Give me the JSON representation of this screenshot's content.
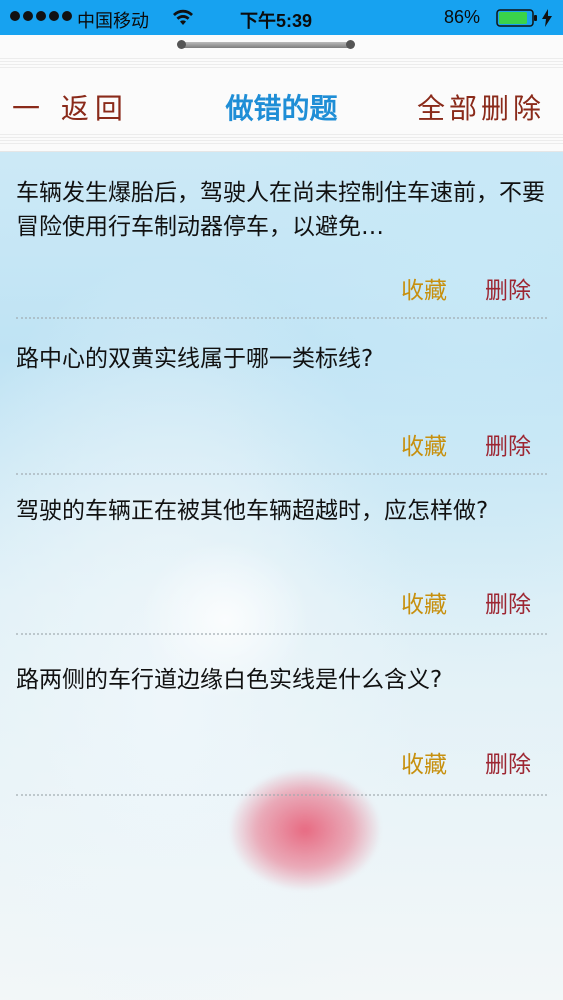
{
  "status_bar": {
    "carrier": "中国移动",
    "time": "下午5:39",
    "battery": "86%"
  },
  "nav": {
    "back_label": "一 返回",
    "title": "做错的题",
    "delete_all_label": "全部删除"
  },
  "questions": [
    {
      "text": "车辆发生爆胎后，驾驶人在尚未控制住车速前，不要冒险使用行车制动器停车，以避免…",
      "favorite_label": "收藏",
      "delete_label": "删除"
    },
    {
      "text": "路中心的双黄实线属于哪一类标线?",
      "favorite_label": "收藏",
      "delete_label": "删除"
    },
    {
      "text": "驾驶的车辆正在被其他车辆超越时，应怎样做?",
      "favorite_label": "收藏",
      "delete_label": "删除"
    },
    {
      "text": "路两侧的车行道边缘白色实线是什么含义?",
      "favorite_label": "收藏",
      "delete_label": "删除"
    }
  ],
  "colors": {
    "status_bar_bg": "#17a2f0",
    "title": "#1f8ed6",
    "favorite": "#c7900f",
    "delete": "#9d2632",
    "nav_side_text": "#8a2a1a",
    "battery_fill": "#3ad34a"
  },
  "icons": [
    "signal-icon",
    "wifi-icon",
    "battery-icon",
    "charging-icon"
  ]
}
